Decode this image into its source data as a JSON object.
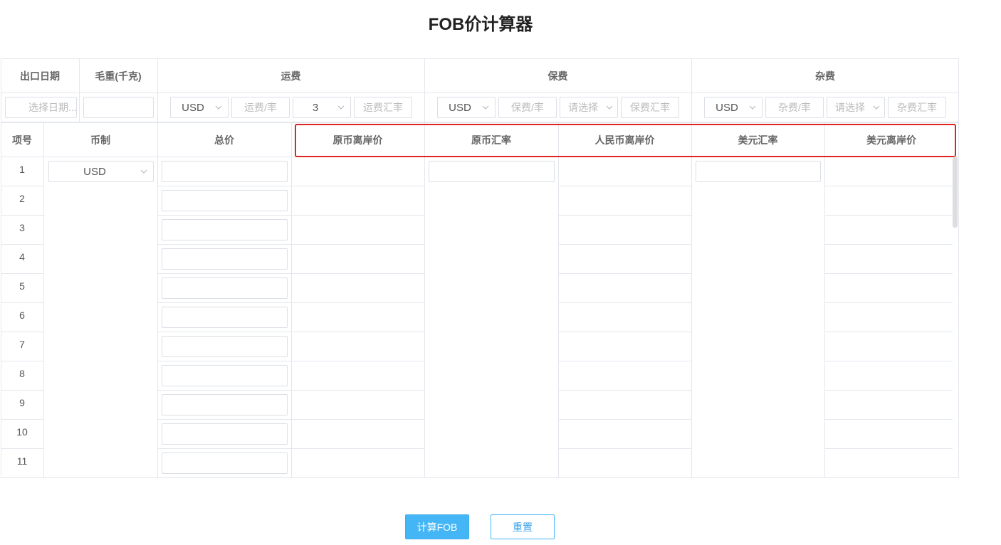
{
  "title": "FOB价计算器",
  "top_headers": {
    "export_date": "出口日期",
    "gross_weight": "毛重(千克)",
    "freight": "运费",
    "insurance": "保费",
    "misc": "杂费"
  },
  "top_inputs": {
    "date_placeholder": "选择日期...",
    "freight": {
      "currency": "USD",
      "rate_placeholder": "运费/率",
      "mode": "3",
      "exrate_placeholder": "运费汇率"
    },
    "insurance": {
      "currency": "USD",
      "rate_placeholder": "保费/率",
      "mode_placeholder": "请选择",
      "exrate_placeholder": "保费汇率"
    },
    "misc": {
      "currency": "USD",
      "rate_placeholder": "杂费/率",
      "mode_placeholder": "请选择",
      "exrate_placeholder": "杂费汇率"
    }
  },
  "columns": {
    "item_no": "项号",
    "currency": "币制",
    "total_price": "总价",
    "orig_fob": "原币离岸价",
    "orig_rate": "原币汇率",
    "rmb_fob": "人民币离岸价",
    "usd_rate": "美元汇率",
    "usd_fob": "美元离岸价"
  },
  "row_currency": "USD",
  "rows": [
    "1",
    "2",
    "3",
    "4",
    "5",
    "6",
    "7",
    "8",
    "9",
    "10",
    "11"
  ],
  "buttons": {
    "calculate": "计算FOB",
    "reset": "重置"
  },
  "colors": {
    "primary": "#45b6f5",
    "highlight": "#e02424"
  }
}
